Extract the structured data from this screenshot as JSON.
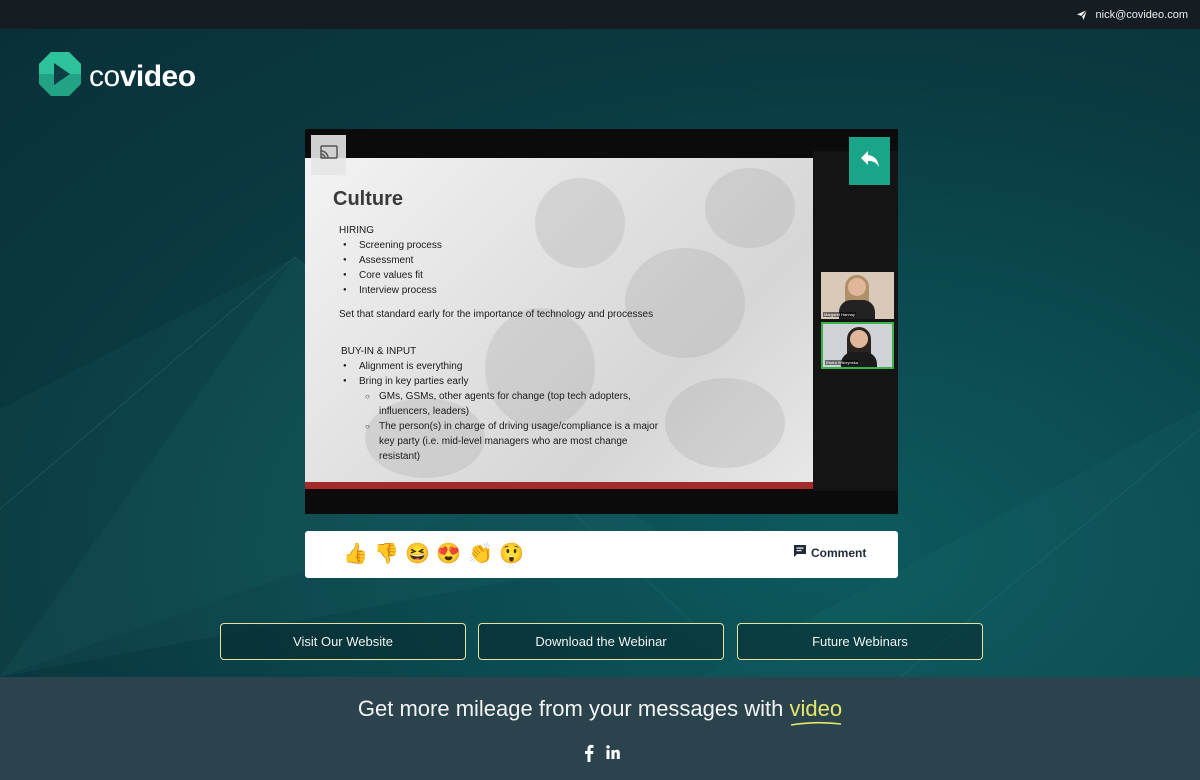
{
  "topbar": {
    "email": "nick@covideo.com",
    "icon": "send-icon"
  },
  "brand": {
    "name_light": "co",
    "name_bold": "video",
    "icon": "covideo-logo-icon"
  },
  "video": {
    "cast_icon": "cast-icon",
    "share_icon": "reply-share-icon",
    "slide": {
      "title": "Culture",
      "section1": "HIRING",
      "hiring_items": [
        "Screening process",
        "Assessment",
        "Core values fit",
        "Interview process"
      ],
      "statement": "Set that standard early for the importance of technology and processes",
      "section2": "BUY-IN & INPUT",
      "buyin_items": [
        "Alignment is everything",
        "Bring in key parties early"
      ],
      "sub_items": [
        "GMs, GSMs, other agents for change (top tech adopters, influencers, leaders)",
        "The person(s) in charge of driving usage/compliance is a major key party (i.e. mid-level managers who are most change resistant)"
      ]
    },
    "participants": [
      {
        "name": "Margaret Hannay"
      },
      {
        "name": "Elwira Wilczynska"
      }
    ]
  },
  "reactions": {
    "emojis": [
      "👍",
      "👎",
      "😆",
      "😍",
      "👏",
      "😲"
    ],
    "emoji_names": [
      "thumbs-up-icon",
      "thumbs-down-icon",
      "laughing-icon",
      "heart-eyes-icon",
      "clapping-icon",
      "surprised-icon"
    ],
    "comment_label": "Comment"
  },
  "cta_buttons": [
    "Visit Our Website",
    "Download the Webinar",
    "Future Webinars"
  ],
  "footer": {
    "tagline_prefix": "Get more mileage from your messages with ",
    "tagline_highlight": "video",
    "social": [
      "facebook-icon",
      "linkedin-icon"
    ]
  },
  "colors": {
    "accent": "#1aa58a",
    "highlight": "#e6e66c",
    "background": "#0c3e44",
    "footer": "#2b434c"
  }
}
